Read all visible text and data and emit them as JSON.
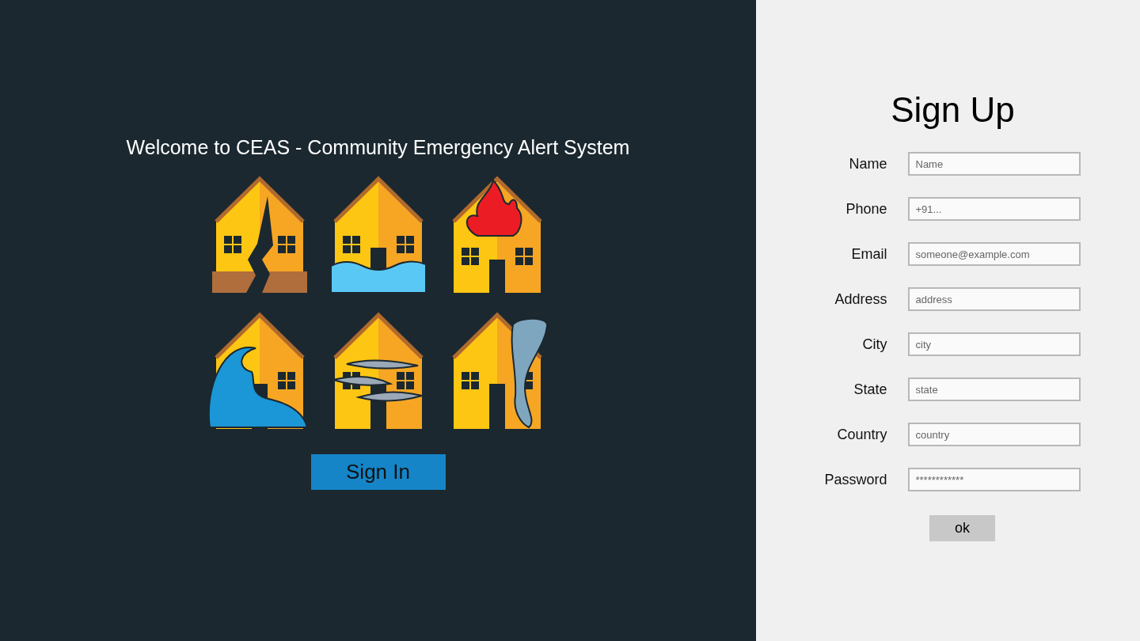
{
  "welcome": {
    "title": "Welcome to CEAS - Community Emergency Alert System",
    "sign_in_button": "Sign In"
  },
  "sign_up": {
    "title": "Sign Up",
    "fields": [
      {
        "label": "Name",
        "placeholder": "Name"
      },
      {
        "label": "Phone",
        "placeholder": "+91..."
      },
      {
        "label": "Email",
        "placeholder": "someone@example.com"
      },
      {
        "label": "Address",
        "placeholder": "address"
      },
      {
        "label": "City",
        "placeholder": "city"
      },
      {
        "label": "State",
        "placeholder": "state"
      },
      {
        "label": "Country",
        "placeholder": "country"
      },
      {
        "label": "Password",
        "placeholder": "************"
      }
    ],
    "ok_button": "ok"
  }
}
